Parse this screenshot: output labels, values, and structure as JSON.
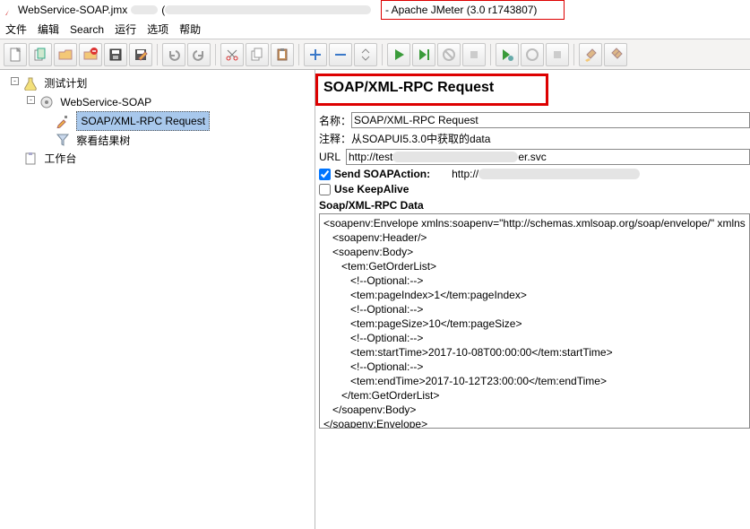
{
  "title": {
    "file": "WebService-SOAP.jmx",
    "app": "- Apache JMeter (3.0 r1743807)"
  },
  "menu": {
    "file": "文件",
    "edit": "编辑",
    "search": "Search",
    "run": "运行",
    "options": "选项",
    "help": "帮助"
  },
  "tree": {
    "root": "测试计划",
    "tg": "WebService-SOAP",
    "req": "SOAP/XML-RPC Request",
    "vt": "察看结果树",
    "wb": "工作台"
  },
  "panel": {
    "heading": "SOAP/XML-RPC Request",
    "name_label": "名称：",
    "name_value": "SOAP/XML-RPC Request",
    "comment_label": "注释：",
    "comment_value": "从SOAPUI5.3.0中获取的data",
    "url_label": "URL",
    "url_prefix": "http://test",
    "url_suffix": "er.svc",
    "send_soap_label": "Send SOAPAction:",
    "soapaction_prefix": "http://",
    "keepalive_label": "Use KeepAlive",
    "data_label": "Soap/XML-RPC Data",
    "xml": "<soapenv:Envelope xmlns:soapenv=\"http://schemas.xmlsoap.org/soap/envelope/\" xmlns\n   <soapenv:Header/>\n   <soapenv:Body>\n      <tem:GetOrderList>\n         <!--Optional:-->\n         <tem:pageIndex>1</tem:pageIndex>\n         <!--Optional:-->\n         <tem:pageSize>10</tem:pageSize>\n         <!--Optional:-->\n         <tem:startTime>2017-10-08T00:00:00</tem:startTime>\n         <!--Optional:-->\n         <tem:endTime>2017-10-12T23:00:00</tem:endTime>\n      </tem:GetOrderList>\n   </soapenv:Body>\n</soapenv:Envelope>"
  }
}
